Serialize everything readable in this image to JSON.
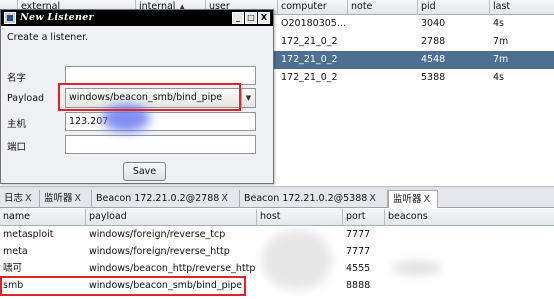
{
  "sessions_table": {
    "columns": [
      "external",
      "internal",
      "user",
      "computer",
      "note",
      "pid",
      "last"
    ],
    "sort_icon": "sort-ascending-icon",
    "rows": [
      {
        "computer": "O20180305...",
        "pid": "3040",
        "last": "4s",
        "selected": false
      },
      {
        "computer": "172_21_0_2",
        "pid": "2788",
        "last": "7m",
        "selected": false
      },
      {
        "computer": "172_21_0_2",
        "pid": "4548",
        "last": "7m",
        "selected": true
      },
      {
        "computer": "172_21_0_2",
        "pid": "5388",
        "last": "4s",
        "selected": false
      }
    ]
  },
  "dialog": {
    "title": "New Listener",
    "minimize_label": "_",
    "maximize_label": "□",
    "close_label": "X",
    "description": "Create a listener.",
    "name_label": "名字",
    "name_value": "",
    "payload_label": "Payload",
    "payload_value": "windows/beacon_smb/bind_pipe",
    "host_label": "主机",
    "host_value": "123.207",
    "port_label": "端口",
    "port_value": "",
    "save_label": "Save"
  },
  "tabs": [
    {
      "label": "日志",
      "close": "X"
    },
    {
      "label": "监听器",
      "close": "X"
    },
    {
      "label": "Beacon 172.21.0.2@2788",
      "close": "X"
    },
    {
      "label": "Beacon 172.21.0.2@5388",
      "close": "X"
    },
    {
      "label": "监听器",
      "close": "X",
      "active": true
    }
  ],
  "listeners_table": {
    "columns": [
      "name",
      "payload",
      "host",
      "port",
      "beacons"
    ],
    "rows": [
      {
        "name": "metasploit",
        "payload": "windows/foreign/reverse_tcp",
        "port": "7777"
      },
      {
        "name": "meta",
        "payload": "windows/foreign/reverse_http",
        "port": "7777"
      },
      {
        "name": "啸可",
        "payload": "windows/beacon_http/reverse_http",
        "port": "4555"
      },
      {
        "name": "smb",
        "payload": "windows/beacon_smb/bind_pipe",
        "port": "8888"
      }
    ]
  },
  "colors": {
    "selection": "#4e6f92",
    "annotation_red": "#e0242b",
    "redaction_blue": "#6d7cf0"
  }
}
